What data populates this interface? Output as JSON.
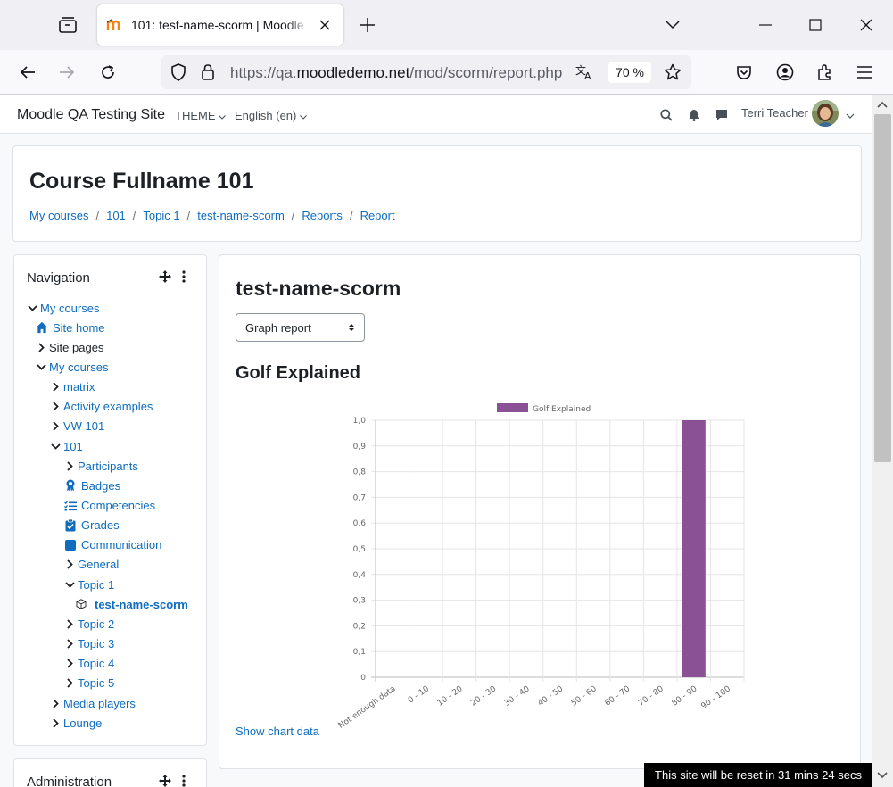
{
  "browser": {
    "tab_title": "101: test-name-scorm | Moodle",
    "url_prefix": "https://qa.",
    "url_host": "moodledemo.net",
    "url_path": "/mod/scorm/report.php",
    "zoom": "70 %"
  },
  "header": {
    "site_name": "Moodle QA Testing Site",
    "theme_menu": "THEME",
    "language_menu": "English (en)",
    "user_name": "Terri Teacher"
  },
  "course": {
    "title": "Course Fullname 101",
    "breadcrumb": [
      "My courses",
      "101",
      "Topic 1",
      "test-name-scorm",
      "Reports",
      "Report"
    ]
  },
  "navigation": {
    "title": "Navigation",
    "items": [
      {
        "label": "My courses",
        "level": 0,
        "chevron": "down",
        "icon": ""
      },
      {
        "label": "Site home",
        "level": 1,
        "chevron": "",
        "icon": "home-icon"
      },
      {
        "label": "Site pages",
        "level": 1,
        "chevron": "right",
        "icon": "",
        "plain": true
      },
      {
        "label": "My courses",
        "level": 1,
        "chevron": "down",
        "icon": ""
      },
      {
        "label": "matrix",
        "level": 2,
        "chevron": "right",
        "icon": ""
      },
      {
        "label": "Activity examples",
        "level": 2,
        "chevron": "right",
        "icon": ""
      },
      {
        "label": "VW 101",
        "level": 2,
        "chevron": "right",
        "icon": ""
      },
      {
        "label": "101",
        "level": 2,
        "chevron": "down",
        "icon": ""
      },
      {
        "label": "Participants",
        "level": 3,
        "chevron": "right",
        "icon": ""
      },
      {
        "label": "Badges",
        "level": 3,
        "chevron": "",
        "icon": "badge-icon"
      },
      {
        "label": "Competencies",
        "level": 3,
        "chevron": "",
        "icon": "competencies-icon"
      },
      {
        "label": "Grades",
        "level": 3,
        "chevron": "",
        "icon": "grades-icon"
      },
      {
        "label": "Communication",
        "level": 3,
        "chevron": "",
        "icon": "communication-icon"
      },
      {
        "label": "General",
        "level": 3,
        "chevron": "right",
        "icon": ""
      },
      {
        "label": "Topic 1",
        "level": 3,
        "chevron": "down",
        "icon": ""
      },
      {
        "label": "test-name-scorm",
        "level": 4,
        "chevron": "",
        "icon": "scorm-package-icon",
        "active": true
      },
      {
        "label": "Topic 2",
        "level": 3,
        "chevron": "right",
        "icon": ""
      },
      {
        "label": "Topic 3",
        "level": 3,
        "chevron": "right",
        "icon": ""
      },
      {
        "label": "Topic 4",
        "level": 3,
        "chevron": "right",
        "icon": ""
      },
      {
        "label": "Topic 5",
        "level": 3,
        "chevron": "right",
        "icon": ""
      },
      {
        "label": "Media players",
        "level": 2,
        "chevron": "right",
        "icon": ""
      },
      {
        "label": "Lounge",
        "level": 2,
        "chevron": "right",
        "icon": ""
      }
    ]
  },
  "administration": {
    "title": "Administration"
  },
  "main": {
    "activity_title": "test-name-scorm",
    "report_select": "Graph report",
    "chart_heading": "Golf Explained",
    "show_chart_data": "Show chart data"
  },
  "chart_data": {
    "type": "bar",
    "categories": [
      "Not enough data",
      "0 - 10",
      "10 - 20",
      "20 - 30",
      "30 - 40",
      "40 - 50",
      "50 - 60",
      "60 - 70",
      "70 - 80",
      "80 - 90",
      "90 - 100"
    ],
    "series": [
      {
        "name": "Golf Explained",
        "values": [
          0,
          0,
          0,
          0,
          0,
          0,
          0,
          0,
          0,
          1,
          0
        ],
        "color": "#8a5295"
      }
    ],
    "yticks": [
      "0",
      "0,1",
      "0,2",
      "0,3",
      "0,4",
      "0,5",
      "0,6",
      "0,7",
      "0,8",
      "0,9",
      "1,0"
    ],
    "ylim": [
      0,
      1
    ],
    "grid": true,
    "legend": "top"
  },
  "reset_banner": "This site will be reset in 31 mins 24 secs"
}
